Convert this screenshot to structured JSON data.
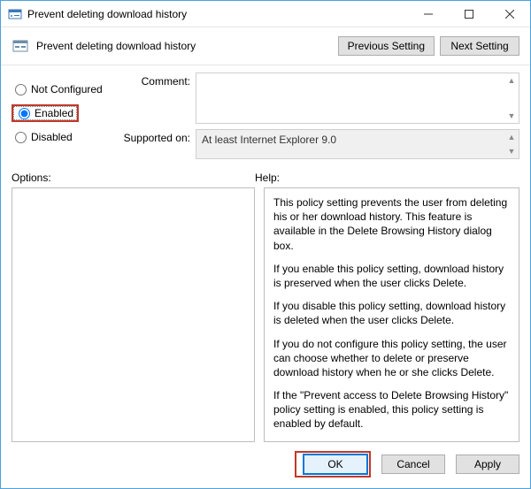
{
  "titlebar": {
    "title": "Prevent deleting download history"
  },
  "toolbar": {
    "title": "Prevent deleting download history",
    "prev_button": "Previous Setting",
    "next_button": "Next Setting"
  },
  "radios": {
    "not_configured": "Not Configured",
    "enabled": "Enabled",
    "disabled": "Disabled",
    "selected": "enabled"
  },
  "fields": {
    "comment_label": "Comment:",
    "comment_value": "",
    "supported_label": "Supported on:",
    "supported_value": "At least Internet Explorer 9.0"
  },
  "sections": {
    "options_label": "Options:",
    "help_label": "Help:"
  },
  "help_paragraphs": [
    "This policy setting prevents the user from deleting his or her download history. This feature is available in the Delete Browsing History dialog box.",
    "If you enable this policy setting, download history is preserved when the user clicks Delete.",
    "If you disable this policy setting, download history is deleted when the user clicks Delete.",
    "If you do not configure this policy setting, the user can choose whether to delete or preserve download history when he or she clicks Delete.",
    "If the \"Prevent access to Delete Browsing History\" policy setting is enabled, this policy setting is enabled by default."
  ],
  "footer": {
    "ok": "OK",
    "cancel": "Cancel",
    "apply": "Apply"
  }
}
